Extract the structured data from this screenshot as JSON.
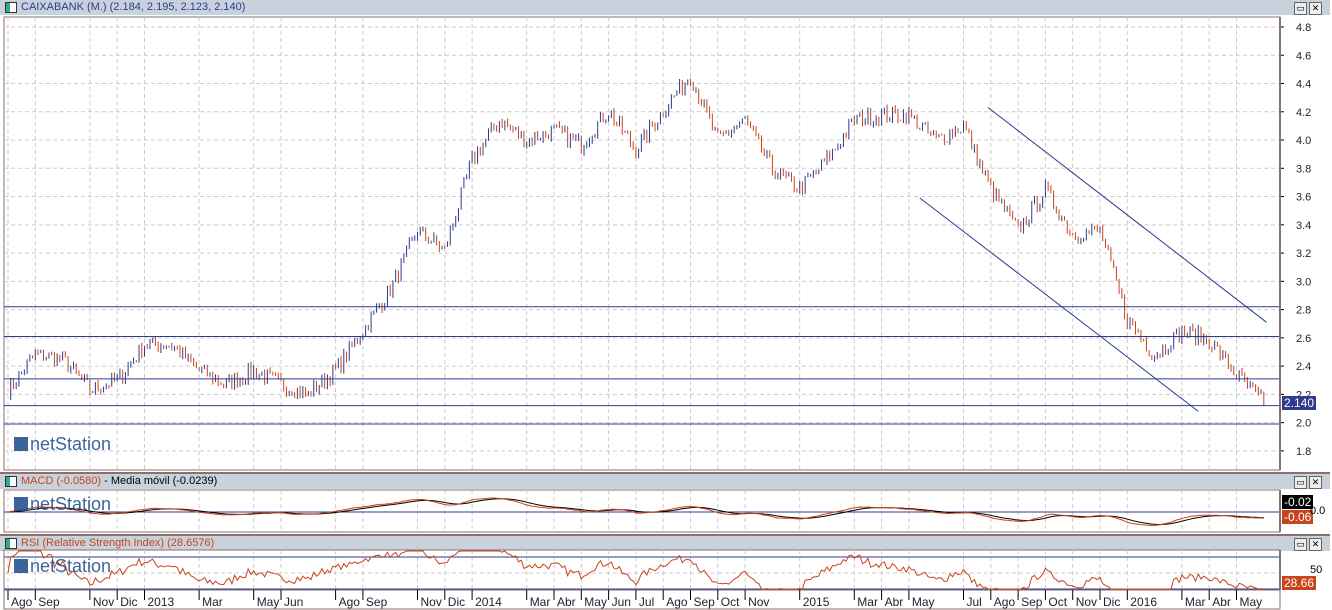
{
  "main": {
    "title": "CAIXABANK (M.) (2.184, 2.195, 2.123, 2.140)",
    "last_label": "2.140"
  },
  "macd": {
    "title_macd": "MACD (-0.0580)",
    "title_ma": "Media móvil (-0.0239)",
    "val_signal": "-0.02",
    "val_macd": "-0.06",
    "zero_label": "0.0"
  },
  "rsi": {
    "title": "RSI (Relative Strength Index) (28.6576)",
    "val": "28.66",
    "level_label": "50"
  },
  "watermark": "netStation",
  "colors": {
    "up": "#2e3b8f",
    "down": "#c9441a",
    "line": "#2e3b8f",
    "macd": "#c9441a",
    "signal": "#000000"
  },
  "chart_data": {
    "type": "candlestick",
    "title": "CAIXABANK (M.)",
    "ylim": [
      1.7,
      4.85
    ],
    "yticks": [
      "1.8",
      "2.0",
      "2.2",
      "2.4",
      "2.6",
      "2.8",
      "3.0",
      "3.2",
      "3.4",
      "3.6",
      "3.8",
      "4.0",
      "4.2",
      "4.4",
      "4.6",
      "4.8"
    ],
    "x_unit": "months since Aug 2012",
    "xticks": [
      {
        "m": 0,
        "label": "Ago"
      },
      {
        "m": 1,
        "label": "Sep"
      },
      {
        "m": 3,
        "label": "Nov"
      },
      {
        "m": 4,
        "label": "Dic"
      },
      {
        "m": 5,
        "label": "2013"
      },
      {
        "m": 7,
        "label": "Mar"
      },
      {
        "m": 9,
        "label": "May"
      },
      {
        "m": 10,
        "label": "Jun"
      },
      {
        "m": 12,
        "label": "Ago"
      },
      {
        "m": 13,
        "label": "Sep"
      },
      {
        "m": 15,
        "label": "Nov"
      },
      {
        "m": 16,
        "label": "Dic"
      },
      {
        "m": 17,
        "label": "2014"
      },
      {
        "m": 19,
        "label": "Mar"
      },
      {
        "m": 20,
        "label": "Abr"
      },
      {
        "m": 21,
        "label": "May"
      },
      {
        "m": 22,
        "label": "Jun"
      },
      {
        "m": 23,
        "label": "Jul"
      },
      {
        "m": 24,
        "label": "Ago"
      },
      {
        "m": 25,
        "label": "Sep"
      },
      {
        "m": 26,
        "label": "Oct"
      },
      {
        "m": 27,
        "label": "Nov"
      },
      {
        "m": 29,
        "label": "2015"
      },
      {
        "m": 31,
        "label": "Mar"
      },
      {
        "m": 32,
        "label": "Abr"
      },
      {
        "m": 33,
        "label": "May"
      },
      {
        "m": 35,
        "label": "Jul"
      },
      {
        "m": 36,
        "label": "Ago"
      },
      {
        "m": 37,
        "label": "Sep"
      },
      {
        "m": 38,
        "label": "Oct"
      },
      {
        "m": 39,
        "label": "Nov"
      },
      {
        "m": 40,
        "label": "Dic"
      },
      {
        "m": 41,
        "label": "2016"
      },
      {
        "m": 43,
        "label": "Mar"
      },
      {
        "m": 44,
        "label": "Abr"
      },
      {
        "m": 45,
        "label": "May"
      }
    ],
    "monthly_close": [
      2.23,
      2.48,
      2.45,
      2.23,
      2.3,
      2.55,
      2.55,
      2.37,
      2.27,
      2.37,
      2.27,
      2.2,
      2.37,
      2.65,
      2.94,
      3.36,
      3.22,
      3.86,
      4.14,
      4.0,
      4.07,
      3.97,
      4.21,
      3.93,
      4.21,
      4.46,
      4.0,
      4.14,
      3.79,
      3.65,
      3.86,
      4.14,
      4.18,
      4.18,
      4.0,
      4.1,
      3.65,
      3.36,
      3.65,
      3.33,
      3.36,
      2.73,
      2.48,
      2.65,
      2.58,
      2.34,
      2.14
    ],
    "hlines": [
      2.82,
      2.61,
      2.31,
      2.12,
      1.99
    ],
    "trendlines": [
      {
        "from": [
          35.9,
          4.23
        ],
        "to": [
          46.1,
          2.71
        ]
      },
      {
        "from": [
          33.4,
          3.59
        ],
        "to": [
          43.6,
          2.08
        ]
      }
    ],
    "macd_last": -0.058,
    "signal_last": -0.0239,
    "rsi_last": 28.6576,
    "rsi_levels": [
      30,
      70
    ]
  }
}
